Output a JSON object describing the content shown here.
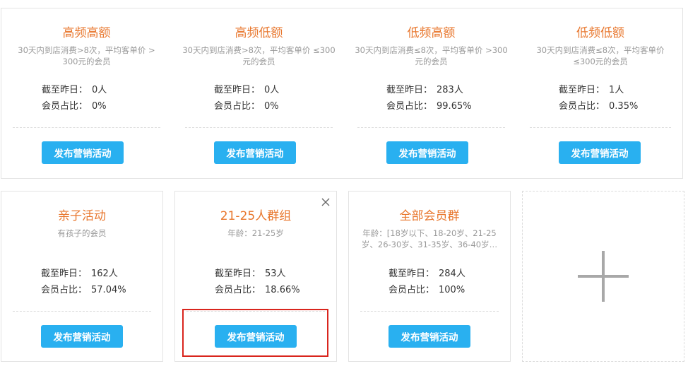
{
  "top_cards": [
    {
      "title": "高频高额",
      "desc": "30天内到店消费>8次，平均客单价 > 300元的会员",
      "count_label": "截至昨日：",
      "count_value": "0人",
      "ratio_label": "会员占比：",
      "ratio_value": "0%",
      "button": "发布营销活动"
    },
    {
      "title": "高频低额",
      "desc": "30天内到店消费>8次，平均客单价 ≤300元的会员",
      "count_label": "截至昨日：",
      "count_value": "0人",
      "ratio_label": "会员占比：",
      "ratio_value": "0%",
      "button": "发布营销活动"
    },
    {
      "title": "低频高额",
      "desc": "30天内到店消费≤8次，平均客单价 >300元的会员",
      "count_label": "截至昨日：",
      "count_value": "283人",
      "ratio_label": "会员占比：",
      "ratio_value": "99.65%",
      "button": "发布营销活动"
    },
    {
      "title": "低频低额",
      "desc": "30天内到店消费≤8次，平均客单价 ≤300元的会员",
      "count_label": "截至昨日：",
      "count_value": "1人",
      "ratio_label": "会员占比：",
      "ratio_value": "0.35%",
      "button": "发布营销活动"
    }
  ],
  "groups": [
    {
      "title": "亲子活动",
      "desc": "有孩子的会员",
      "count_label": "截至昨日：",
      "count_value": "162人",
      "ratio_label": "会员占比：",
      "ratio_value": "57.04%",
      "button": "发布营销活动"
    },
    {
      "title": "21-25人群组",
      "desc": "年龄：21-25岁",
      "count_label": "截至昨日：",
      "count_value": "53人",
      "ratio_label": "会员占比：",
      "ratio_value": "18.66%",
      "button": "发布营销活动"
    },
    {
      "title": "全部会员群",
      "desc": "年龄：[18岁以下、18-20岁、21-25岁、26-30岁、31-35岁、36-40岁…",
      "count_label": "截至昨日：",
      "count_value": "284人",
      "ratio_label": "会员占比：",
      "ratio_value": "100%",
      "button": "发布营销活动"
    }
  ],
  "icons": {
    "edit": "pencil-icon",
    "close": "close-icon",
    "add": "plus-icon"
  },
  "colors": {
    "title": "#e8762c",
    "button": "#29b0f0",
    "highlight": "#d9251d"
  }
}
